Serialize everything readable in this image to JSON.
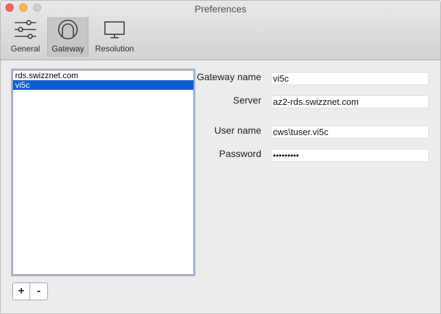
{
  "window": {
    "title": "Preferences"
  },
  "toolbar": {
    "items": [
      {
        "label": "General",
        "icon": "sliders-icon",
        "selected": false
      },
      {
        "label": "Gateway",
        "icon": "gateway-icon",
        "selected": true
      },
      {
        "label": "Resolution",
        "icon": "monitor-icon",
        "selected": false
      }
    ]
  },
  "gateway_list": {
    "items": [
      {
        "label": "rds.swizznet.com",
        "selected": false
      },
      {
        "label": "vi5c",
        "selected": true
      }
    ],
    "add_label": "+",
    "remove_label": "-"
  },
  "form": {
    "gateway_name_label": "Gateway name",
    "gateway_name_value": "vi5c",
    "server_label": "Server",
    "server_value": "az2-rds.swizznet.com",
    "user_name_label": "User name",
    "user_name_value": "cws\\tuser.vi5c",
    "password_label": "Password",
    "password_value": "•••••••••"
  },
  "colors": {
    "selection": "#0a5ed4",
    "close": "#fc605c",
    "minimize": "#fdbc40",
    "maximize": "#cfcfcf"
  }
}
